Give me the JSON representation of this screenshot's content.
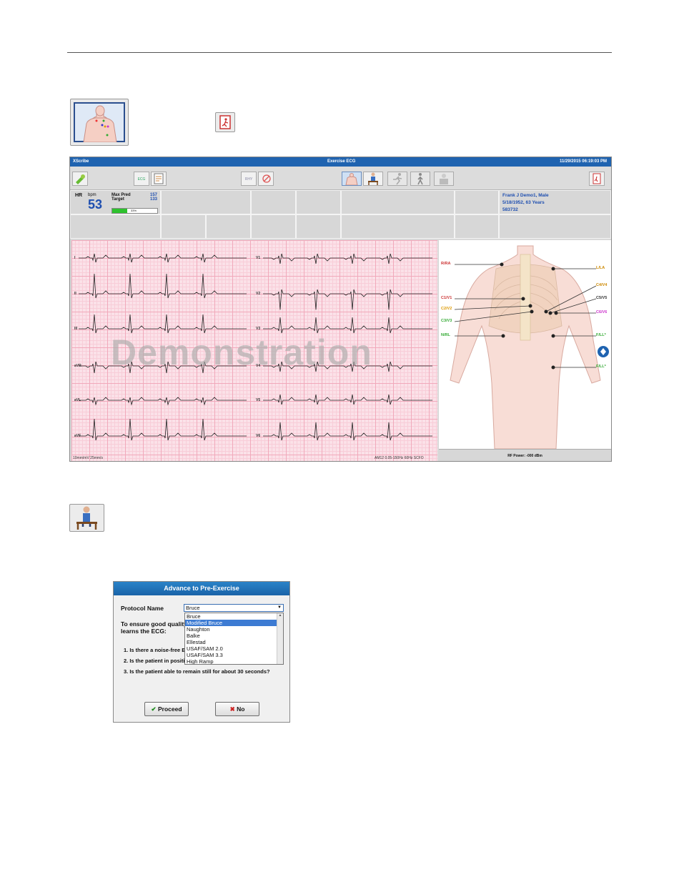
{
  "app": {
    "name": "XScribe",
    "screen_title": "Exercise ECG",
    "datetime": "11/29/2015 06:19:03 PM"
  },
  "toolbar": {
    "ecg_label": "ECG",
    "rhy_label": "RHY"
  },
  "vitals": {
    "hr_label": "HR",
    "bpm_label": "bpm",
    "hr_value": "53",
    "max_pred_label": "Max Pred",
    "max_pred_value": "157",
    "target_label": "Target",
    "target_value": "133",
    "target_percent_text": "33%",
    "target_percent": 33
  },
  "patient": {
    "name_line": "Frank J Demo1, Male",
    "dob_line": "5/18/1952, 63 Years",
    "id": "583732"
  },
  "ecg": {
    "leads_left": [
      "I",
      "II",
      "III",
      "aVR",
      "aVL",
      "aVF"
    ],
    "leads_right": [
      "V1",
      "V2",
      "V3",
      "V4",
      "V5",
      "V6"
    ],
    "watermark": "Demonstration",
    "footer_left": "10mm/mV  25mm/s",
    "footer_right": "AM12     0.05-150Hz  60Hz    SCFO"
  },
  "electrodes": {
    "left_side": [
      "R/RA",
      "C1/V1",
      "C2/V2",
      "C3/V3",
      "N/RL"
    ],
    "right_side": [
      "L/LA",
      "C4/V4",
      "C5/V5",
      "C6/V6",
      "F/LL*",
      "F/LL*"
    ],
    "rf_power": "RF Power: -000 dBm"
  },
  "dialog": {
    "title": "Advance to Pre-Exercise",
    "protocol_label": "Protocol Name",
    "selected": "Bruce",
    "options": [
      "Bruce",
      "Modified Bruce",
      "Naughton",
      "Balke",
      "Ellestad",
      "USAF/SAM 2.0",
      "USAF/SAM 3.3",
      "High Ramp"
    ],
    "highlighted_index": 1,
    "intro_line1": "To ensure good quality",
    "intro_line2": "learns the ECG:",
    "q1": "1.  Is there a noise-free EC",
    "q2": "2.  Is the patient in positio",
    "q3": "3.  Is the patient able to remain still for about 30 seconds?",
    "proceed_label": "Proceed",
    "no_label": "No"
  },
  "colors": {
    "titlebar": "#1f63b0",
    "hr_value": "#1f4fb0",
    "patient_text": "#1f4fb0",
    "grid": "#fbe1e8"
  }
}
